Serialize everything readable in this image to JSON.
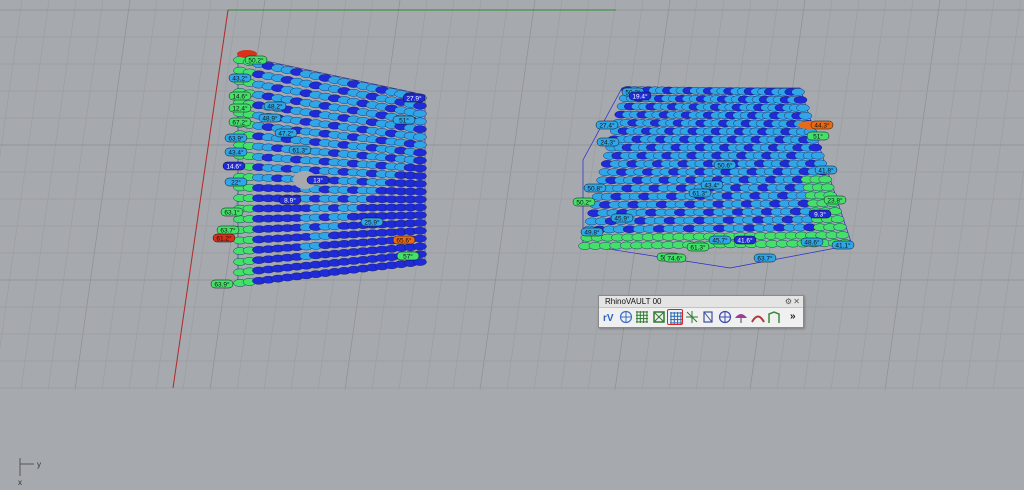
{
  "toolbar": {
    "title": "RhinoVAULT 00",
    "gear_glyph": "⚙",
    "close_glyph": "✕",
    "more_glyph": "»",
    "buttons": [
      {
        "icon": "rv-logo-icon",
        "label": "rV"
      },
      {
        "icon": "form-diagram-icon"
      },
      {
        "icon": "grid-hash-icon"
      },
      {
        "icon": "mesh-grid-icon"
      },
      {
        "icon": "table-grid-icon",
        "highlighted": true
      },
      {
        "icon": "star-network-icon"
      },
      {
        "icon": "box-frame-icon"
      },
      {
        "icon": "sphere-mesh-icon"
      },
      {
        "icon": "umbrella-icon"
      },
      {
        "icon": "vault-shape-icon"
      },
      {
        "icon": "supports-icon"
      }
    ]
  },
  "axes": {
    "y_label": "y",
    "x_label": "x"
  },
  "colors": {
    "background": "#a6a9ad",
    "grid_minor": "#9b9ea2",
    "grid_major": "#8d9094",
    "axis_x": "#b02a2a",
    "axis_y": "#2e8b2e",
    "label_blue": "#1f2ad8",
    "label_lightblue": "#2fa6e8",
    "label_green": "#43e06a",
    "label_orange": "#e86a18",
    "label_red": "#d8301a",
    "highlight_red": "#d22222"
  },
  "left_mesh": {
    "labels": [
      {
        "text": "50.2°",
        "c": "g"
      },
      {
        "text": "43.2°",
        "c": "lb"
      },
      {
        "text": "14.6°",
        "c": "g"
      },
      {
        "text": "12.4°",
        "c": "g"
      },
      {
        "text": "67.2°",
        "c": "g"
      },
      {
        "text": "47.2°",
        "c": "lb"
      },
      {
        "text": "63.9°",
        "c": "lb"
      },
      {
        "text": "48.2°",
        "c": "lb"
      },
      {
        "text": "43.4°",
        "c": "lb"
      },
      {
        "text": "14.6°",
        "c": "b"
      },
      {
        "text": "22°",
        "c": "lb"
      },
      {
        "text": "63.1°",
        "c": "g"
      },
      {
        "text": "63.7°",
        "c": "g"
      },
      {
        "text": "61.2°",
        "c": "r"
      },
      {
        "text": "63.9°",
        "c": "g"
      },
      {
        "text": "27.9°",
        "c": "b"
      },
      {
        "text": "51°",
        "c": "lb"
      },
      {
        "text": "13°",
        "c": "b"
      },
      {
        "text": "65.6°",
        "c": "o"
      },
      {
        "text": "57°",
        "c": "g"
      },
      {
        "text": "8.9°",
        "c": "b"
      },
      {
        "text": "61.3°",
        "c": "lb"
      },
      {
        "text": "48.9°",
        "c": "lb"
      },
      {
        "text": "25.9°",
        "c": "lb"
      }
    ]
  },
  "right_mesh": {
    "labels": [
      {
        "text": "27.4°",
        "c": "lb"
      },
      {
        "text": "24.3°",
        "c": "lb"
      },
      {
        "text": "50.8°",
        "c": "lb"
      },
      {
        "text": "50.2°",
        "c": "g"
      },
      {
        "text": "49.8°",
        "c": "lb"
      },
      {
        "text": "45.9°",
        "c": "lb"
      },
      {
        "text": "61.3°",
        "c": "g"
      },
      {
        "text": "53.7°",
        "c": "g"
      },
      {
        "text": "74.6°",
        "c": "g"
      },
      {
        "text": "63.7°",
        "c": "lb"
      },
      {
        "text": "41.1°",
        "c": "lb"
      },
      {
        "text": "48.6°",
        "c": "lb"
      },
      {
        "text": "45.7°",
        "c": "lb"
      },
      {
        "text": "41.6°",
        "c": "b"
      },
      {
        "text": "44.3°",
        "c": "o"
      },
      {
        "text": "41.8°",
        "c": "lb"
      },
      {
        "text": "43.4°",
        "c": "lb"
      },
      {
        "text": "61.3°",
        "c": "lb"
      },
      {
        "text": "50.6°",
        "c": "lb"
      },
      {
        "text": "50.2°",
        "c": "lb"
      },
      {
        "text": "19.4°",
        "c": "b"
      },
      {
        "text": "23.8°",
        "c": "g"
      },
      {
        "text": "9.3°",
        "c": "b"
      },
      {
        "text": "51°",
        "c": "g"
      }
    ]
  }
}
